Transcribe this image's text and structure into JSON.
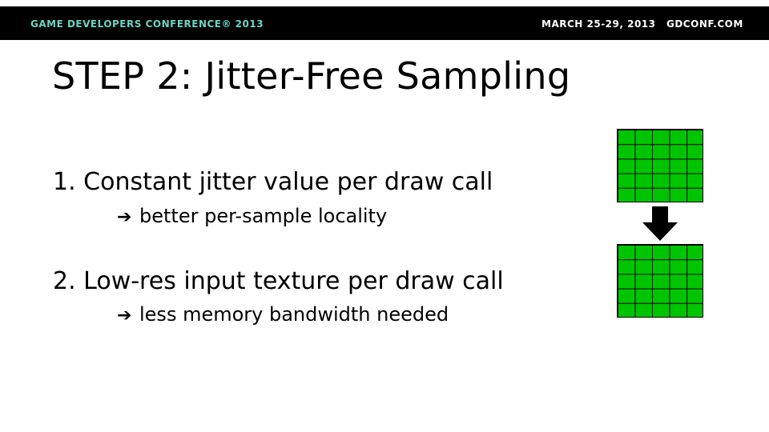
{
  "header": {
    "brand": "GAME DEVELOPERS CONFERENCE® 2013",
    "dates": "MARCH 25-29, 2013",
    "site": "GDCONF.COM"
  },
  "slide": {
    "title": "STEP 2: Jitter-Free Sampling",
    "points": [
      {
        "text": "1. Constant jitter value per draw call",
        "sub": "better per-sample locality"
      },
      {
        "text": "2. Low-res input texture per draw call",
        "sub": "less memory bandwidth needed"
      }
    ],
    "arrow_glyph": "➔"
  },
  "diagram": {
    "grid_color": "#00c400",
    "grid_columns": 5,
    "grid_rows": 5,
    "arrow_icon": "down-arrow-icon"
  }
}
